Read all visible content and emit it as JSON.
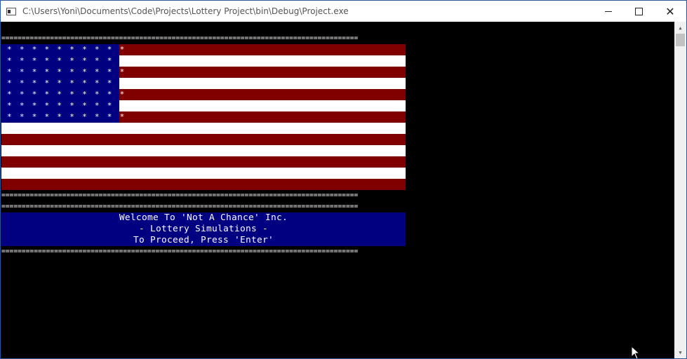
{
  "window": {
    "title": "C:\\Users\\Yoni\\Documents\\Code\\Projects\\Lottery Project\\bin\\Debug\\Project.exe",
    "controls": {
      "minimize": "minimize",
      "maximize": "maximize",
      "close": "✕"
    }
  },
  "console": {
    "separator": "========================================================================================",
    "flag": {
      "stripe_colors": [
        "#800000",
        "#ffffff"
      ],
      "stripe_count": 13,
      "canton_color": "#000080",
      "star_rows": [
        "* * * * * * * * * *",
        "* * * * * * * * * *",
        "* * * * * * * * * *",
        "* * * * * * * * * *",
        "* * * * * * * * * *",
        "* * * * * * * * * *",
        "* * * * * * * * * *"
      ]
    },
    "banner": {
      "background": "#000080",
      "lines": [
        "Welcome To 'Not A Chance' Inc.",
        "- Lottery Simulations -",
        "To Proceed, Press 'Enter'"
      ]
    }
  },
  "colors": {
    "console_bg": "#000000",
    "text": "#ffffff",
    "stripe_red": "#800000",
    "navy": "#000080"
  }
}
